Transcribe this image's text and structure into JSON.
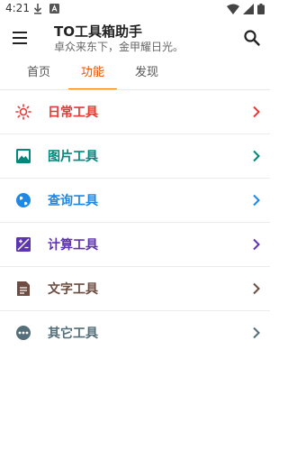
{
  "status_bar": {
    "time": "4:21",
    "left_icons": [
      "download-icon",
      "app-notification-icon"
    ],
    "right_icons": [
      "wifi-icon",
      "signal-icon",
      "battery-icon"
    ]
  },
  "app_bar": {
    "title": "TO工具箱助手",
    "subtitle": "卓众来东下，金甲耀日光。",
    "menu_icon": "menu-icon",
    "search_icon": "search-icon"
  },
  "tabs": [
    {
      "label": "首页",
      "active": false
    },
    {
      "label": "功能",
      "active": true
    },
    {
      "label": "发现",
      "active": false
    }
  ],
  "tools": [
    {
      "label": "日常工具",
      "icon": "sun-icon",
      "color": "#e53935"
    },
    {
      "label": "图片工具",
      "icon": "image-icon",
      "color": "#00897b"
    },
    {
      "label": "查询工具",
      "icon": "globe-icon",
      "color": "#1e88e5"
    },
    {
      "label": "计算工具",
      "icon": "calculator-icon",
      "color": "#5e35b1"
    },
    {
      "label": "文字工具",
      "icon": "document-icon",
      "color": "#6d4c41"
    },
    {
      "label": "其它工具",
      "icon": "more-icon",
      "color": "#546e7a"
    }
  ],
  "colors": {
    "accent": "#f57c00",
    "active_tab_text": "#e65100",
    "divider": "#ececec"
  }
}
